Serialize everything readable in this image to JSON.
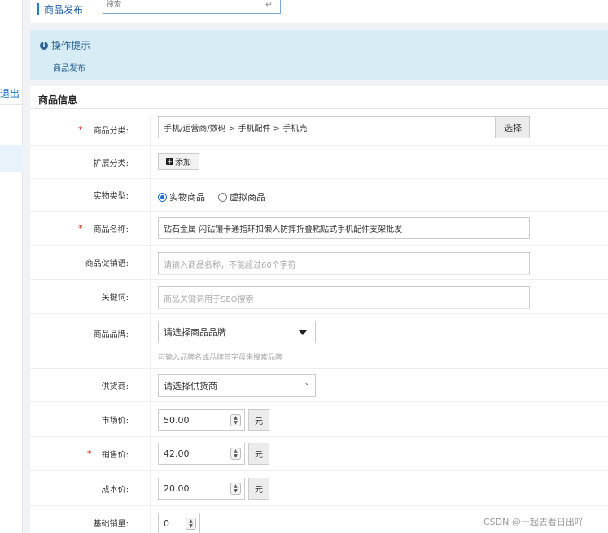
{
  "sidebar": {
    "logout_label": "退出"
  },
  "header": {
    "title": "商品发布",
    "search_placeholder": "搜索",
    "enter_glyph": "↵"
  },
  "tip": {
    "title": "操作提示",
    "text": "商品发布"
  },
  "section": {
    "title": "商品信息"
  },
  "form": {
    "category": {
      "label": "商品分类:",
      "value": "手机/运营商/数码 > 手机配件 > 手机壳",
      "button": "选择",
      "required": "*"
    },
    "ext_category": {
      "label": "扩展分类:",
      "button": "添加"
    },
    "type": {
      "label": "实物类型:",
      "options": [
        "实物商品",
        "虚拟商品"
      ],
      "selected": "实物商品"
    },
    "name": {
      "label": "商品名称:",
      "value": "钻石金属 闪钻镶卡通指环扣懒人防摔折叠粘贴式手机配件支架批发",
      "required": "*"
    },
    "promo": {
      "label": "商品促销语:",
      "placeholder": "请输入商品名称，不能超过60个字符"
    },
    "keywords": {
      "label": "关键词:",
      "placeholder": "商品关键词用于SEO搜索"
    },
    "brand": {
      "label": "商品品牌:",
      "value": "请选择商品品牌",
      "hint": "可输入品牌名或品牌首字母来搜索品牌"
    },
    "supplier": {
      "label": "供货商:",
      "value": "请选择供货商"
    },
    "market_price": {
      "label": "市场价:",
      "value": "50.00",
      "unit": "元"
    },
    "sale_price": {
      "label": "销售价:",
      "value": "42.00",
      "unit": "元",
      "required": "*"
    },
    "cost_price": {
      "label": "成本价:",
      "value": "20.00",
      "unit": "元"
    },
    "base_sales": {
      "label": "基础销量:",
      "value": "0"
    }
  },
  "watermark": "CSDN @一起去看日出吖"
}
